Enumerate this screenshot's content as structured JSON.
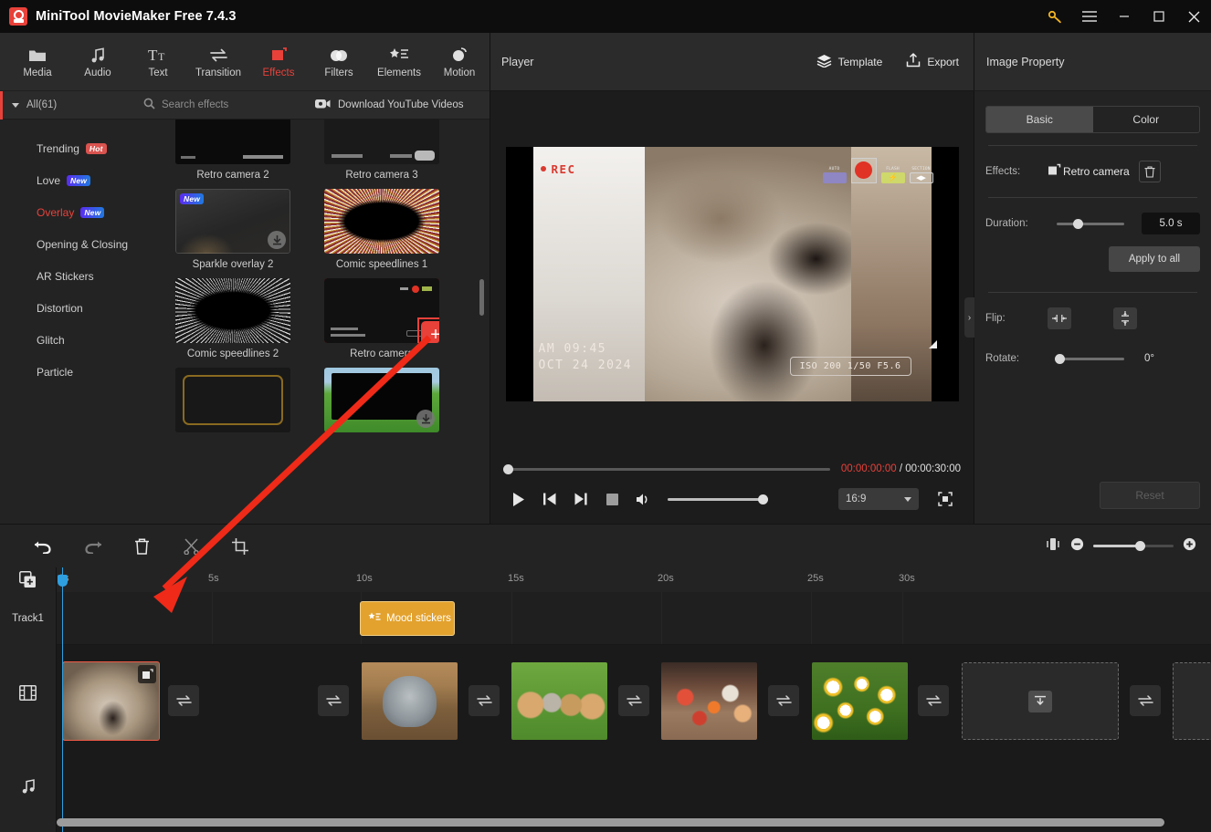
{
  "titlebar": {
    "app_title": "MiniTool MovieMaker Free 7.4.3",
    "logo_icon": "app-logo-icon",
    "buttons": [
      {
        "name": "key-icon",
        "glyph": "key"
      },
      {
        "name": "menu-icon",
        "glyph": "hamburger"
      },
      {
        "name": "minimize-icon",
        "glyph": "minimize"
      },
      {
        "name": "maximize-icon",
        "glyph": "maximize"
      },
      {
        "name": "close-icon",
        "glyph": "close"
      }
    ]
  },
  "ribbon": {
    "items": [
      {
        "label": "Media",
        "icon": "folder-icon",
        "active": false
      },
      {
        "label": "Audio",
        "icon": "music-note-icon",
        "active": false
      },
      {
        "label": "Text",
        "icon": "text-icon",
        "active": false
      },
      {
        "label": "Transition",
        "icon": "transition-icon",
        "active": false
      },
      {
        "label": "Effects",
        "icon": "effects-icon",
        "active": true
      },
      {
        "label": "Filters",
        "icon": "filters-icon",
        "active": false
      },
      {
        "label": "Elements",
        "icon": "elements-icon",
        "active": false
      },
      {
        "label": "Motion",
        "icon": "motion-icon",
        "active": false
      }
    ]
  },
  "effects_panel": {
    "all_label": "All(61)",
    "search_placeholder": "Search effects",
    "youtube_label": "Download YouTube Videos",
    "categories": [
      {
        "label": "Trending",
        "badge": "Hot",
        "badge_kind": "hot",
        "active": false
      },
      {
        "label": "Love",
        "badge": "New",
        "badge_kind": "new",
        "active": false
      },
      {
        "label": "Overlay",
        "badge": "New",
        "badge_kind": "new",
        "active": true
      },
      {
        "label": "Opening & Closing",
        "badge": "",
        "badge_kind": "",
        "active": false
      },
      {
        "label": "AR Stickers",
        "badge": "",
        "badge_kind": "",
        "active": false
      },
      {
        "label": "Distortion",
        "badge": "",
        "badge_kind": "",
        "active": false
      },
      {
        "label": "Glitch",
        "badge": "",
        "badge_kind": "",
        "active": false
      },
      {
        "label": "Particle",
        "badge": "",
        "badge_kind": "",
        "active": false
      }
    ],
    "items": [
      {
        "name": "Retro camera 2",
        "selected": false,
        "download": false,
        "new": false,
        "art": "retro2"
      },
      {
        "name": "Retro camera 3",
        "selected": false,
        "download": false,
        "new": false,
        "art": "retro3"
      },
      {
        "name": "Sparkle overlay 2",
        "selected": false,
        "download": true,
        "new": true,
        "art": "sparkle"
      },
      {
        "name": "Comic speedlines 1",
        "selected": false,
        "download": false,
        "new": false,
        "art": "comic1"
      },
      {
        "name": "Comic speedlines 2",
        "selected": false,
        "download": false,
        "new": false,
        "art": "comic2"
      },
      {
        "name": "Retro camera",
        "selected": true,
        "download": false,
        "new": false,
        "art": "retro1"
      },
      {
        "name": "",
        "selected": false,
        "download": false,
        "new": false,
        "art": "gold"
      },
      {
        "name": "",
        "selected": false,
        "download": true,
        "new": false,
        "art": "grass"
      }
    ],
    "add_button_label": "+"
  },
  "player": {
    "title": "Player",
    "template_label": "Template",
    "export_label": "Export",
    "current_time": "00:00:00:00",
    "separator": " / ",
    "total_time": "00:00:30:00",
    "aspect_ratio": "16:9",
    "overlay": {
      "rec_label": "REC",
      "auto_label": "AUTO",
      "flash_label": "FLASH",
      "section_label": "SECTION",
      "time_line1": "AM  09:45",
      "time_line2": "OCT  24  2024",
      "iso_text": "ISO 200  1/50  F5.6"
    },
    "controls": [
      {
        "name": "play-button",
        "icon": "play-icon"
      },
      {
        "name": "prev-button",
        "icon": "skip-previous-icon"
      },
      {
        "name": "next-button",
        "icon": "skip-next-icon"
      },
      {
        "name": "stop-button",
        "icon": "stop-icon"
      },
      {
        "name": "volume-button",
        "icon": "volume-icon"
      },
      {
        "name": "fullscreen-button",
        "icon": "fullscreen-icon"
      }
    ]
  },
  "property_panel": {
    "title": "Image Property",
    "tabs": [
      {
        "label": "Basic",
        "active": true
      },
      {
        "label": "Color",
        "active": false
      }
    ],
    "effects_label": "Effects:",
    "effects_value": "Retro camera",
    "duration_label": "Duration:",
    "duration_value": "5.0 s",
    "apply_all_label": "Apply to all",
    "flip_label": "Flip:",
    "rotate_label": "Rotate:",
    "rotate_value": "0°",
    "reset_label": "Reset"
  },
  "timeline": {
    "toolbar": [
      {
        "name": "undo-button",
        "icon": "undo-icon"
      },
      {
        "name": "redo-button",
        "icon": "redo-icon"
      },
      {
        "name": "delete-button",
        "icon": "trash-icon"
      },
      {
        "name": "split-button",
        "icon": "scissors-icon"
      },
      {
        "name": "crop-button",
        "icon": "crop-icon"
      }
    ],
    "zoom_fit_icon": "fit-to-screen-icon",
    "zoom_out_icon": "zoom-out-icon",
    "zoom_in_icon": "zoom-in-icon",
    "add_track_icon": "add-track-icon",
    "ruler_ticks": [
      "0s",
      "5s",
      "10s",
      "15s",
      "20s",
      "25s",
      "30s"
    ],
    "track1_label": "Track1",
    "video_track_icon": "film-strip-icon",
    "audio_track_icon": "music-note-icon",
    "sticker": {
      "label": "Mood stickers",
      "icon": "elements-icon"
    },
    "clips": [
      {
        "name": "dog-clip",
        "art": "im-dog",
        "selected": true,
        "fx_badge": true
      },
      {
        "name": "cat1-clip",
        "art": "im-cat1",
        "selected": false,
        "fx_badge": false
      },
      {
        "name": "cat2-clip",
        "art": "im-cat2",
        "selected": false,
        "fx_badge": false
      },
      {
        "name": "kittens-clip",
        "art": "im-kittens",
        "selected": false,
        "fx_badge": false
      },
      {
        "name": "flowers-clip",
        "art": "im-flowers",
        "selected": false,
        "fx_badge": false
      },
      {
        "name": "daisy-clip",
        "art": "im-daisy",
        "selected": false,
        "fx_badge": false
      }
    ],
    "transition_icon": "transition-icon",
    "dropzone_icon": "import-icon"
  },
  "annotation": {
    "arrow_color": "#ef2a18",
    "highlight_color": "#ef2a18"
  }
}
